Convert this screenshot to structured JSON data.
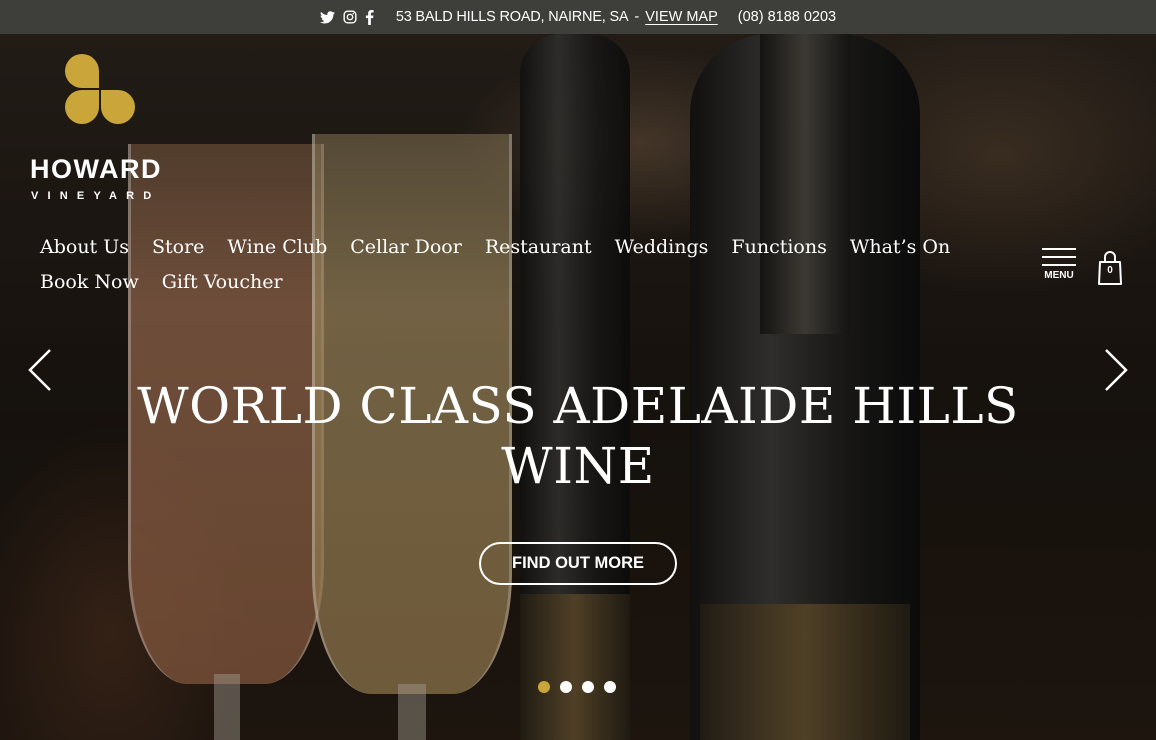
{
  "topbar": {
    "social": [
      {
        "name": "twitter-icon"
      },
      {
        "name": "instagram-icon"
      },
      {
        "name": "facebook-icon"
      }
    ],
    "address": "53 BALD HILLS ROAD, NAIRNE, SA",
    "separator": "-",
    "map_link": "VIEW MAP",
    "phone": "(08) 8188 0203"
  },
  "logo": {
    "word": "HOWARD",
    "sub": "VINEYARD",
    "color": "#c9a53a"
  },
  "nav": {
    "items": [
      "About Us",
      "Store",
      "Wine Club",
      "Cellar Door",
      "Restaurant",
      "Weddings",
      "Functions",
      "What’s On",
      "Book Now",
      "Gift Voucher"
    ]
  },
  "menu_label": "MENU",
  "cart_count": "0",
  "hero": {
    "headline": "WORLD CLASS ADELAIDE HILLS WINE",
    "cta": "FIND OUT MORE",
    "slides": 4,
    "active_slide": 1
  }
}
